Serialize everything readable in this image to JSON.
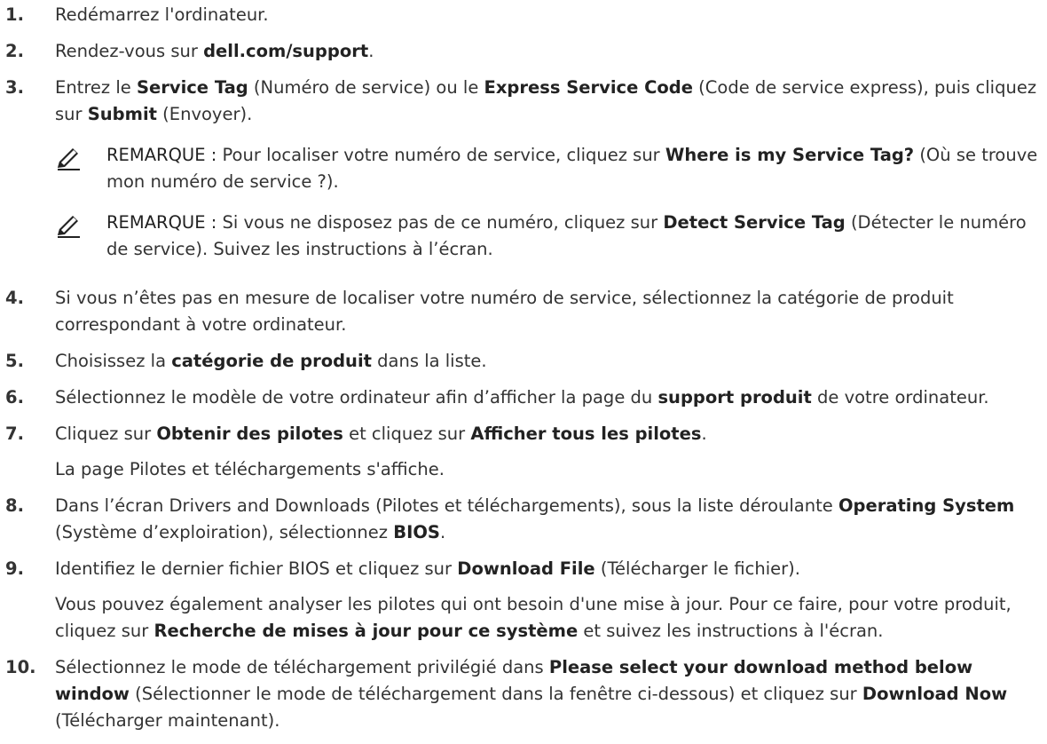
{
  "steps": [
    {
      "num": "1.",
      "parts": [
        {
          "t": "Redémarrez l'ordinateur."
        }
      ]
    },
    {
      "num": "2.",
      "parts": [
        {
          "t": "Rendez-vous sur "
        },
        {
          "t": "dell.com/support",
          "b": true
        },
        {
          "t": "."
        }
      ]
    },
    {
      "num": "3.",
      "parts": [
        {
          "t": "Entrez le "
        },
        {
          "t": "Service Tag",
          "b": true
        },
        {
          "t": " (Numéro de service) ou le "
        },
        {
          "t": "Express Service Code",
          "b": true
        },
        {
          "t": " (Code de service express), puis cliquez sur "
        },
        {
          "t": "Submit",
          "b": true
        },
        {
          "t": " (Envoyer)."
        }
      ],
      "notes": [
        {
          "label": "REMARQUE :",
          "icon": "pencil-note-icon",
          "parts": [
            {
              "t": " Pour localiser votre numéro de service, cliquez sur "
            },
            {
              "t": "Where is my Service Tag?",
              "b": true
            },
            {
              "t": " (Où se trouve mon numéro de service ?)."
            }
          ]
        },
        {
          "label": "REMARQUE :",
          "icon": "pencil-note-icon",
          "parts": [
            {
              "t": " Si vous ne disposez pas de ce numéro, cliquez sur "
            },
            {
              "t": "Detect Service Tag",
              "b": true
            },
            {
              "t": " (Détecter le numéro de service). Suivez les instructions à l’écran."
            }
          ]
        }
      ]
    },
    {
      "num": "4.",
      "parts": [
        {
          "t": "Si vous n’êtes pas en mesure de localiser votre numéro de service, sélectionnez la catégorie de produit correspondant à votre ordinateur."
        }
      ]
    },
    {
      "num": "5.",
      "parts": [
        {
          "t": "Choisissez la "
        },
        {
          "t": "catégorie de produit",
          "b": true
        },
        {
          "t": " dans la liste."
        }
      ]
    },
    {
      "num": "6.",
      "parts": [
        {
          "t": "Sélectionnez le modèle de votre ordinateur afin d’afficher la page du "
        },
        {
          "t": "support produit",
          "b": true
        },
        {
          "t": " de votre ordinateur."
        }
      ]
    },
    {
      "num": "7.",
      "parts": [
        {
          "t": "Cliquez sur "
        },
        {
          "t": "Obtenir des pilotes",
          "b": true
        },
        {
          "t": " et cliquez sur "
        },
        {
          "t": "Afficher tous les pilotes",
          "b": true
        },
        {
          "t": "."
        }
      ],
      "follow": [
        [
          {
            "t": "La page Pilotes et téléchargements s'affiche."
          }
        ]
      ]
    },
    {
      "num": "8.",
      "parts": [
        {
          "t": "Dans l’écran Drivers and Downloads (Pilotes et téléchargements), sous la liste déroulante "
        },
        {
          "t": "Operating System",
          "b": true
        },
        {
          "t": " (Système d’exploiration), sélectionnez "
        },
        {
          "t": "BIOS",
          "b": true
        },
        {
          "t": "."
        }
      ]
    },
    {
      "num": "9.",
      "parts": [
        {
          "t": "Identifiez le dernier fichier BIOS et cliquez sur "
        },
        {
          "t": "Download File",
          "b": true
        },
        {
          "t": " (Télécharger le fichier)."
        }
      ],
      "follow": [
        [
          {
            "t": "Vous pouvez également analyser les pilotes qui ont besoin d'une mise à jour. Pour ce faire, pour votre produit, cliquez sur "
          },
          {
            "t": "Recherche de mises à jour pour ce système",
            "b": true
          },
          {
            "t": " et suivez les instructions à l'écran."
          }
        ]
      ]
    },
    {
      "num": "10.",
      "parts": [
        {
          "t": "Sélectionnez le mode de téléchargement privilégié dans "
        },
        {
          "t": "Please select your download method below window",
          "b": true
        },
        {
          "t": " (Sélectionner le mode de téléchargement dans la fenêtre ci-dessous) et cliquez sur "
        },
        {
          "t": "Download Now",
          "b": true
        },
        {
          "t": " (Télécharger maintenant)."
        }
      ]
    }
  ]
}
